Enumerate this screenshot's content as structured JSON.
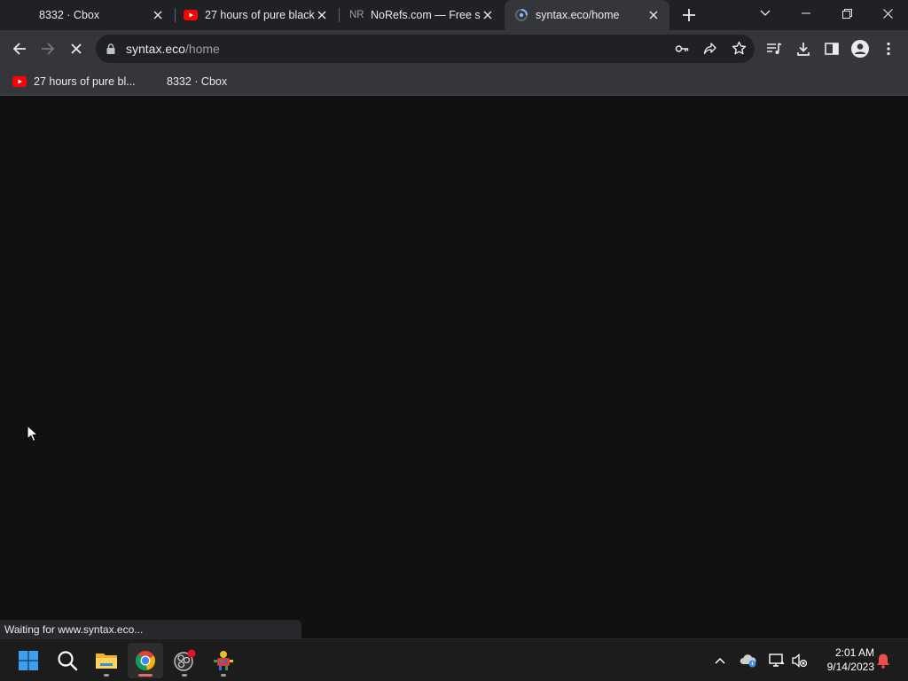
{
  "browser": {
    "tabs": [
      {
        "title": "8332 · Cbox",
        "icon": "cbox-favicon",
        "active": false
      },
      {
        "title": "27 hours of pure black",
        "icon": "youtube-favicon",
        "active": false
      },
      {
        "title": "NoRefs.com — Free se",
        "favicon_text": "NR",
        "active": false
      },
      {
        "title": "syntax.eco/home",
        "icon": "loading-favicon",
        "active": true
      }
    ],
    "address": {
      "domain": "syntax.eco",
      "path": "/home"
    },
    "bookmarks": [
      {
        "label": "27 hours of pure bl...",
        "icon": "youtube-favicon"
      },
      {
        "label": "8332 · Cbox",
        "icon": "none"
      }
    ],
    "status_text": "Waiting for www.syntax.eco..."
  },
  "taskbar": {
    "time": "2:01 AM",
    "date": "9/14/2023"
  },
  "colors": {
    "tabstrip": "#202124",
    "toolbar": "#35363a",
    "page_background": "#111112",
    "youtube_red": "#ff0000",
    "notification_bell": "#e8514b"
  }
}
